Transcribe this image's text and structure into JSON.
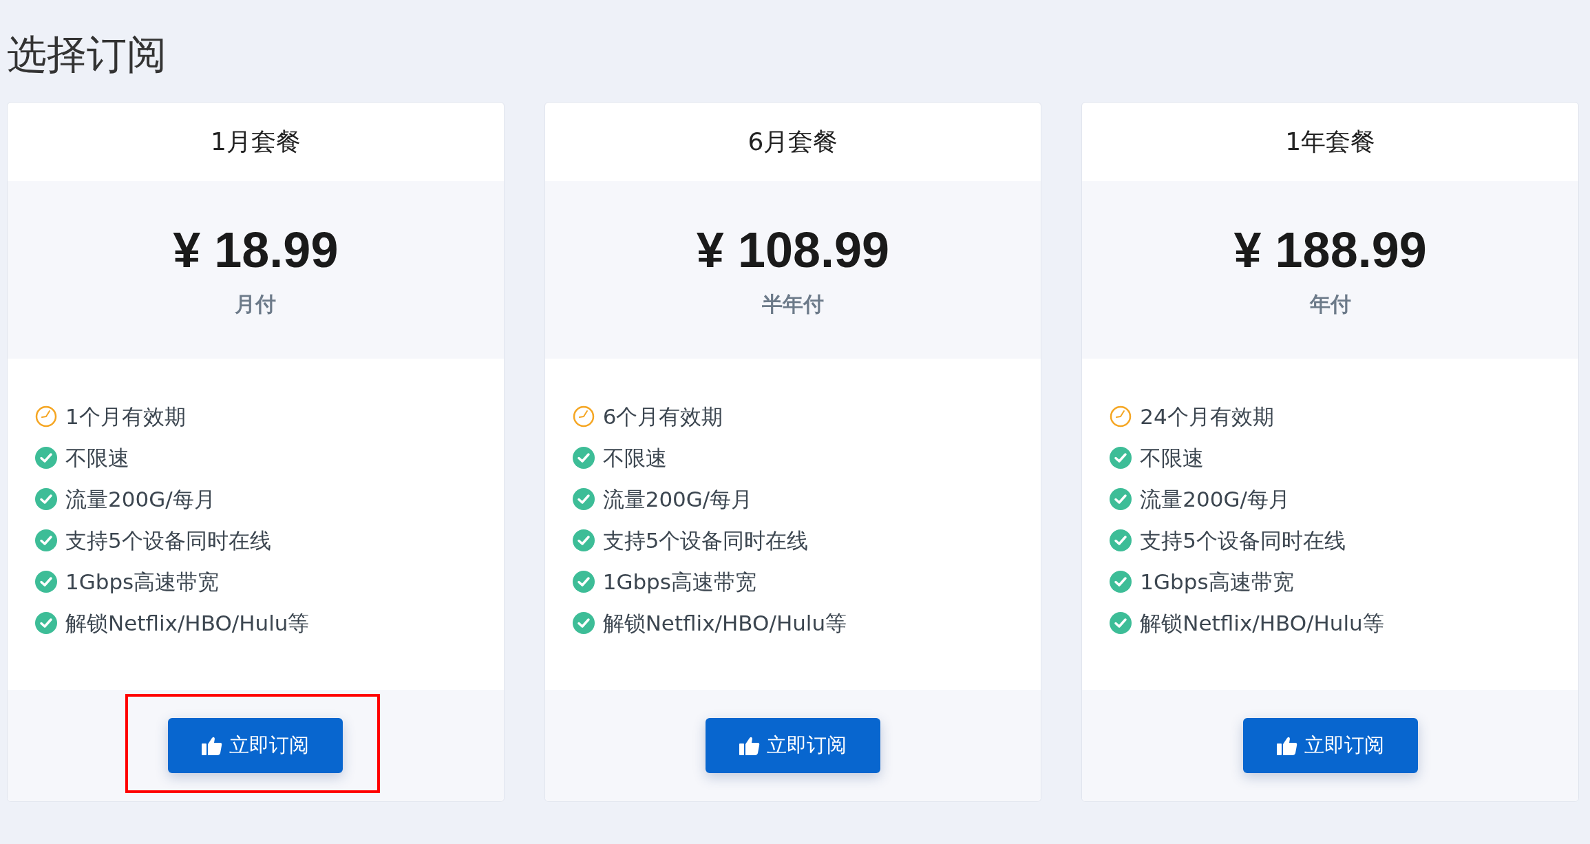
{
  "title": "选择订阅",
  "plans": [
    {
      "name": "1月套餐",
      "price": "¥ 18.99",
      "period": "月付",
      "highlighted": true,
      "button": "立即订阅",
      "features": [
        {
          "kind": "clock",
          "text": "1个月有效期"
        },
        {
          "kind": "check",
          "text": "不限速"
        },
        {
          "kind": "check",
          "text": "流量200G/每月"
        },
        {
          "kind": "check",
          "text": "支持5个设备同时在线"
        },
        {
          "kind": "check",
          "text": "1Gbps高速带宽"
        },
        {
          "kind": "check",
          "text": "解锁Netflix/HBO/Hulu等"
        }
      ]
    },
    {
      "name": "6月套餐",
      "price": "¥ 108.99",
      "period": "半年付",
      "highlighted": false,
      "button": "立即订阅",
      "features": [
        {
          "kind": "clock",
          "text": "6个月有效期"
        },
        {
          "kind": "check",
          "text": "不限速"
        },
        {
          "kind": "check",
          "text": "流量200G/每月"
        },
        {
          "kind": "check",
          "text": "支持5个设备同时在线"
        },
        {
          "kind": "check",
          "text": "1Gbps高速带宽"
        },
        {
          "kind": "check",
          "text": "解锁Netflix/HBO/Hulu等"
        }
      ]
    },
    {
      "name": "1年套餐",
      "price": "¥ 188.99",
      "period": "年付",
      "highlighted": false,
      "button": "立即订阅",
      "features": [
        {
          "kind": "clock",
          "text": "24个月有效期"
        },
        {
          "kind": "check",
          "text": "不限速"
        },
        {
          "kind": "check",
          "text": "流量200G/每月"
        },
        {
          "kind": "check",
          "text": "支持5个设备同时在线"
        },
        {
          "kind": "check",
          "text": "1Gbps高速带宽"
        },
        {
          "kind": "check",
          "text": "解锁Netflix/HBO/Hulu等"
        }
      ]
    }
  ]
}
